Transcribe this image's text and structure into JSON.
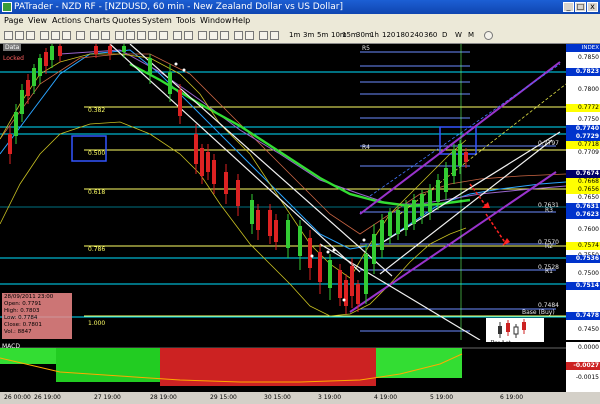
{
  "window": {
    "title": "PATrader - NZD RF - [NZDUSD, 60 min - New Zealand Dollar vs US Dollar]",
    "min": "_",
    "max": "□",
    "close": "x"
  },
  "menu": [
    "Page",
    "View",
    "Actions",
    "Charts",
    "Quotes",
    "System",
    "Tools",
    "Window",
    "Help"
  ],
  "toolbar": {
    "timeframes": [
      "1m",
      "3m",
      "5m",
      "10m",
      "15m",
      "30m",
      "1h",
      "120",
      "180",
      "240",
      "360",
      "D",
      "W",
      "M"
    ]
  },
  "chart": {
    "labels": {
      "data": "Data",
      "locked": "Locked",
      "index": "INDEX"
    },
    "fib_labels": [
      "0.382",
      "0.500",
      "0.618",
      "0.786",
      "1.000"
    ],
    "level_tags": [
      "R5",
      "R4",
      "R3",
      "R2",
      "R1",
      "Base (Buy)"
    ],
    "small_values": [
      "0.7797",
      "0.7631",
      "0.7570",
      "0.7528",
      "0.7484"
    ],
    "colors": {
      "background": "#000000",
      "up_candle": "#33cc33",
      "down_candle": "#dd2222",
      "fib_line": "#ffff66",
      "channel": "#9933cc",
      "green_ma": "#33dd33",
      "cyan_line": "#00ffff"
    }
  },
  "price_axis": [
    {
      "text": "0.7850",
      "hl": false,
      "bg": "#ffffff"
    },
    {
      "text": "0.7823",
      "hl": true,
      "bg": "#0033cc"
    },
    {
      "text": "0.7800",
      "hl": false,
      "bg": "#ffffff"
    },
    {
      "text": "0.7772",
      "hl": false,
      "bg": "#ffff00"
    },
    {
      "text": "0.7750",
      "hl": false,
      "bg": "#ffffff"
    },
    {
      "text": "0.7740",
      "hl": true,
      "bg": "#0033cc"
    },
    {
      "text": "0.7729",
      "hl": true,
      "bg": "#0033cc"
    },
    {
      "text": "0.7718",
      "hl": false,
      "bg": "#ffff00"
    },
    {
      "text": "0.7709",
      "hl": false,
      "bg": "#ffffff"
    },
    {
      "text": "0.7674",
      "hl": true,
      "bg": "#000066"
    },
    {
      "text": "0.7668",
      "hl": false,
      "bg": "#ffff00"
    },
    {
      "text": "0.7656",
      "hl": false,
      "bg": "#ffff00"
    },
    {
      "text": "0.7650",
      "hl": false,
      "bg": "#ffffff"
    },
    {
      "text": "0.7631",
      "hl": true,
      "bg": "#0033cc"
    },
    {
      "text": "0.7623",
      "hl": true,
      "bg": "#0033cc"
    },
    {
      "text": "0.7600",
      "hl": false,
      "bg": "#ffffff"
    },
    {
      "text": "0.7574",
      "hl": false,
      "bg": "#ffff00"
    },
    {
      "text": "0.7550",
      "hl": false,
      "bg": "#ffffff"
    },
    {
      "text": "0.7536",
      "hl": true,
      "bg": "#0033cc"
    },
    {
      "text": "0.7500",
      "hl": false,
      "bg": "#ffffff"
    },
    {
      "text": "0.7514",
      "hl": true,
      "bg": "#0033cc"
    },
    {
      "text": "0.7478",
      "hl": true,
      "bg": "#0033cc"
    },
    {
      "text": "0.7450",
      "hl": false,
      "bg": "#ffffff"
    }
  ],
  "ohlc": {
    "date": "28/09/2011 23:00",
    "open": "Open: 0.7791",
    "high": "High: 0.7803",
    "low": "Low: 0.7784",
    "close": "Close: 0.7801",
    "vol": "Vol.: 8847"
  },
  "macd": {
    "label": "MACD",
    "axis": [
      "0.0000",
      "-0.0027",
      "-0.0015"
    ]
  },
  "time_axis": [
    "26 00:00",
    "26 19:00",
    "27 19:00",
    "28 19:00",
    "29 15:00",
    "30 15:00",
    "3 19:00",
    "4 19:00",
    "5 19:00",
    "6 19:00"
  ],
  "logo": {
    "name": "ProAct",
    "sub": "TRADERS"
  }
}
